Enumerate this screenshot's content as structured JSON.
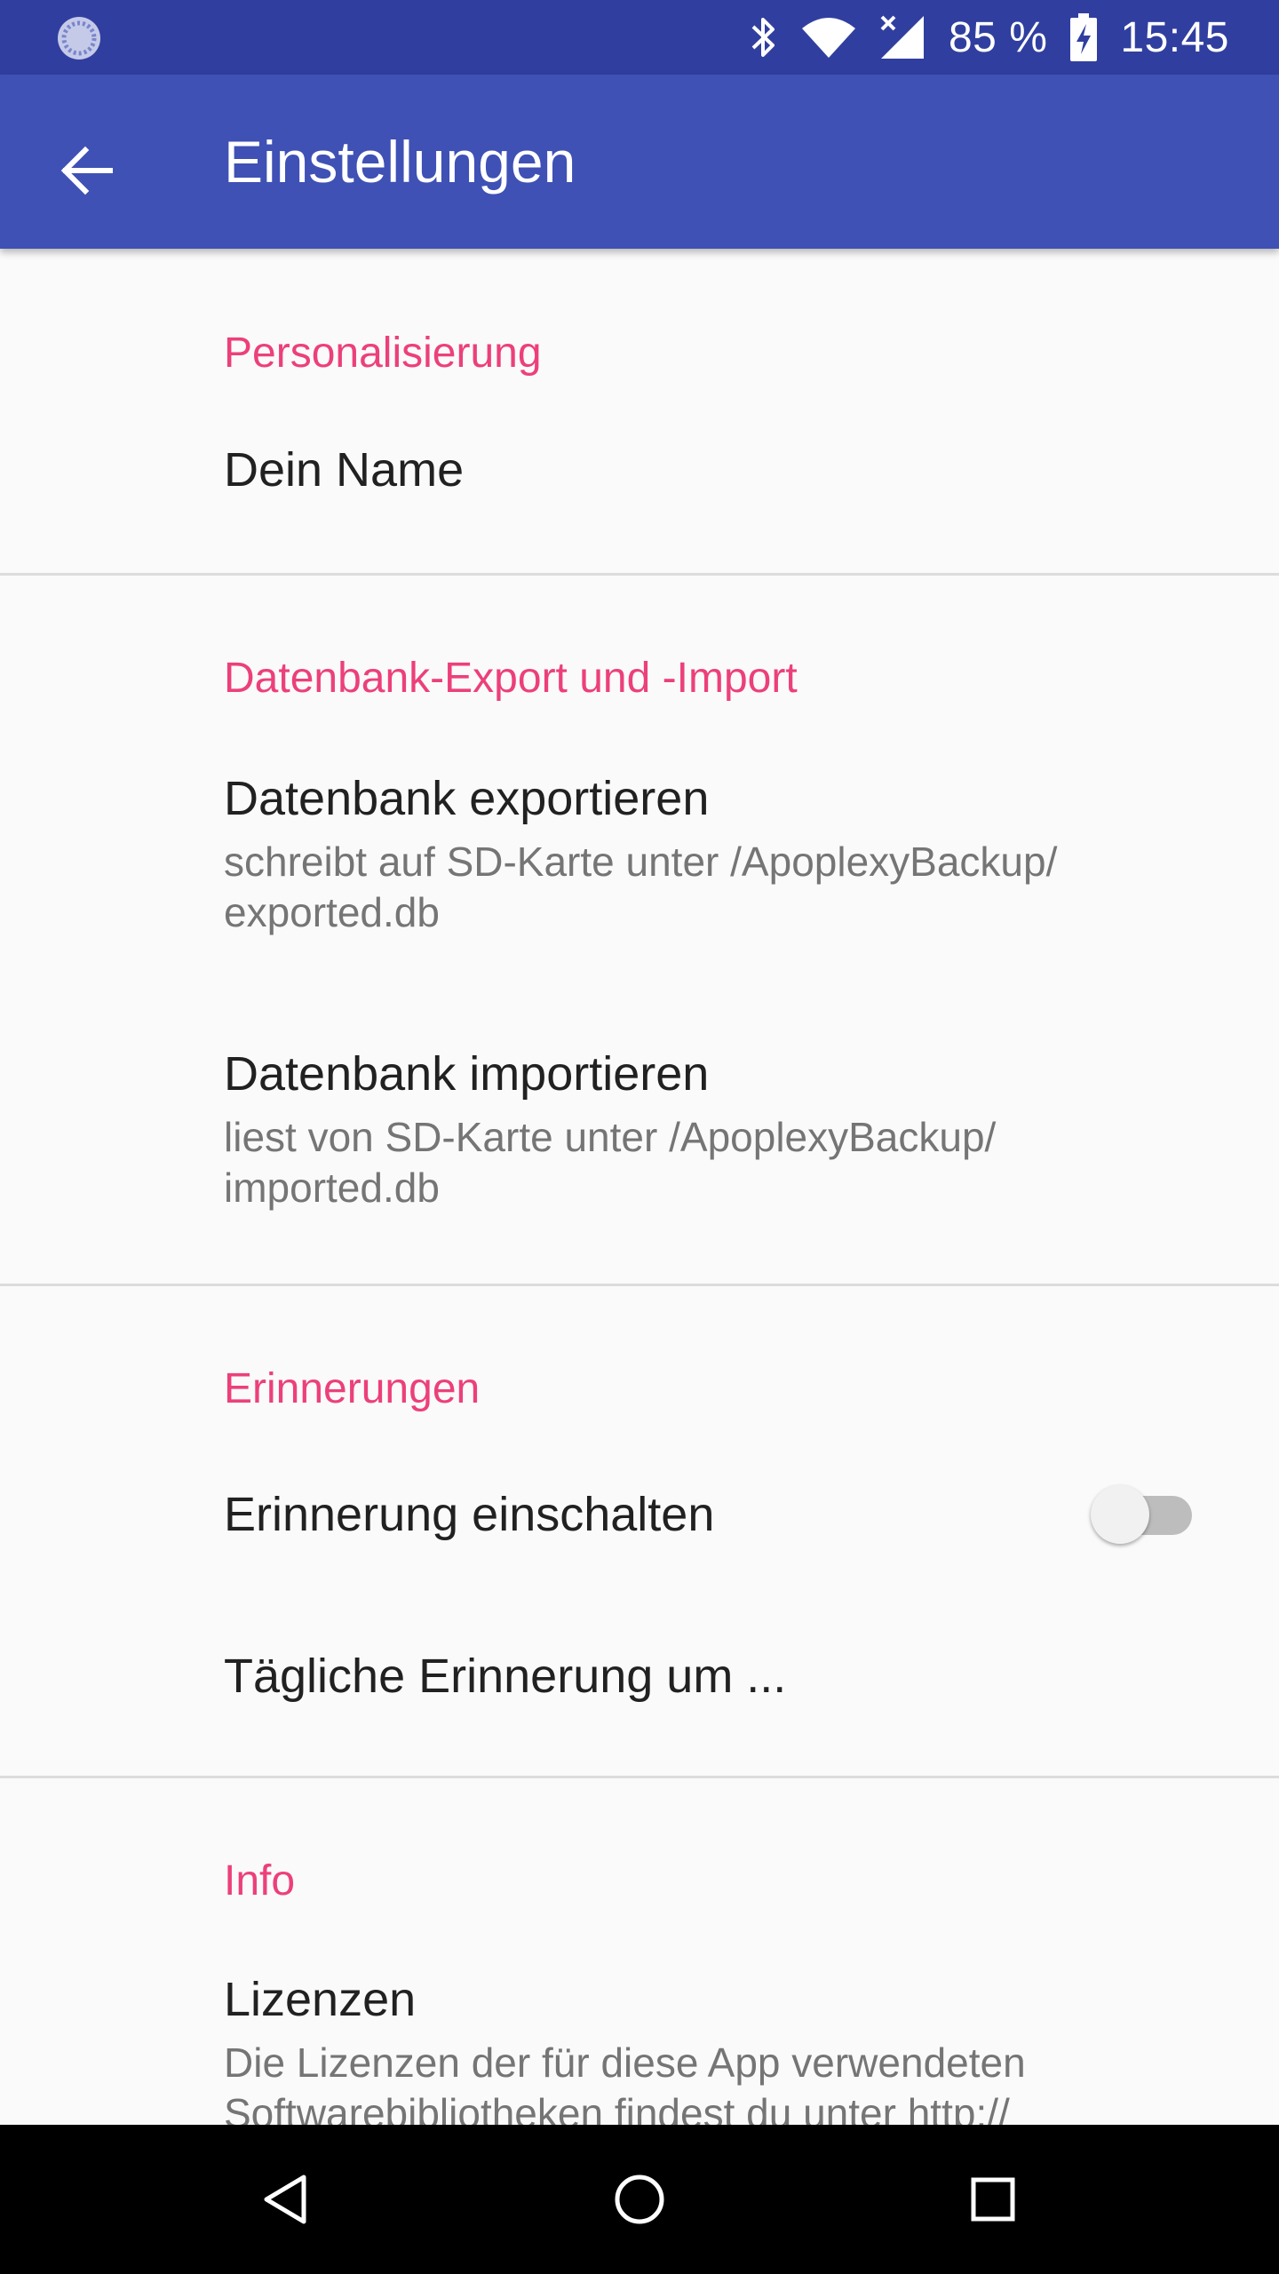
{
  "status_bar": {
    "battery": "85 %",
    "time": "15:45"
  },
  "app_bar": {
    "title": "Einstellungen"
  },
  "sections": {
    "personalisierung": {
      "header": "Personalisierung",
      "name_pref": {
        "title": "Dein Name"
      }
    },
    "datenbank": {
      "header": "Datenbank-Export und -Import",
      "export": {
        "title": "Datenbank exportieren",
        "summary": "schreibt auf SD-Karte unter /ApoplexyBackup/ exported.db"
      },
      "import": {
        "title": "Datenbank importieren",
        "summary": "liest von SD-Karte unter /ApoplexyBackup/ imported.db"
      }
    },
    "erinnerungen": {
      "header": "Erinnerungen",
      "enable": {
        "title": "Erinnerung einschalten",
        "checked": false
      },
      "daily": {
        "title": "Tägliche Erinnerung um ..."
      }
    },
    "info": {
      "header": "Info",
      "licenses": {
        "title": "Lizenzen",
        "summary": "Die Lizenzen der für diese App verwendeten Softwarebibliotheken findest du unter http://"
      }
    }
  },
  "colors": {
    "status_bar": "#303f9f",
    "app_bar": "#3f51b5",
    "accent": "#ec407a",
    "background": "#fafafa"
  },
  "icons": {
    "status_left": "loading-spinner-icon",
    "bluetooth": "bluetooth-icon",
    "wifi": "wifi-icon",
    "signal": "cell-signal-no-data-icon",
    "battery": "battery-charging-icon",
    "back": "arrow-back-icon",
    "nav_back": "nav-back-triangle-icon",
    "nav_home": "nav-home-circle-icon",
    "nav_recents": "nav-recents-square-icon"
  }
}
